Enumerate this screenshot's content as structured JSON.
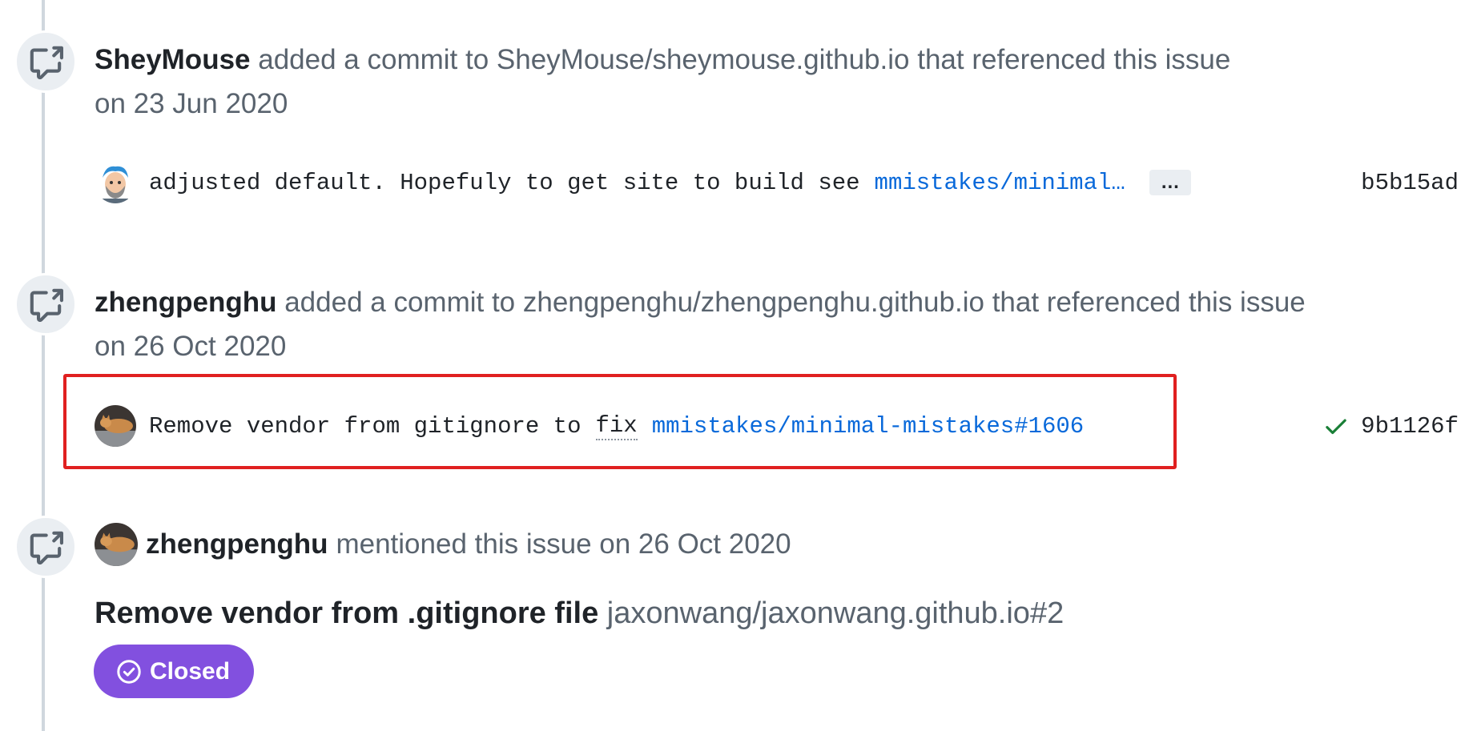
{
  "timeline": {
    "event1": {
      "icon": "cross-reference-icon",
      "actor": "SheyMouse",
      "action_prefix": "added a commit to",
      "repo": "SheyMouse/sheymouse.github.io",
      "action_suffix": "that referenced this issue",
      "date": "on 23 Jun 2020",
      "commit": {
        "avatar": "cartoon-avatar-blue-hair",
        "message": "adjusted default. Hopefuly to get site to build see",
        "link": "mmistakes/minimal…",
        "more_label": "…",
        "sha": "b5b15ad"
      }
    },
    "event2": {
      "icon": "cross-reference-icon",
      "actor": "zhengpenghu",
      "action_prefix": "added a commit to",
      "repo": "zhengpenghu/zhengpenghu.github.io",
      "action_suffix": "that referenced this issue",
      "date": "on 26 Oct 2020",
      "commit": {
        "avatar": "cat-photo-avatar",
        "message_before": "Remove vendor from gitignore to",
        "message_fix": "fix",
        "link": "mmistakes/minimal-mistakes#1606",
        "status": "check-icon",
        "status_color": "#1a7f37",
        "sha": "9b1126f"
      }
    },
    "event3": {
      "icon": "cross-reference-icon",
      "actor": "zhengpenghu",
      "action": "mentioned this issue on 26 Oct 2020",
      "issue_title": "Remove vendor from .gitignore file",
      "issue_ref": "jaxonwang/jaxonwang.github.io#2",
      "state": "Closed",
      "state_color": "#8250df"
    }
  }
}
